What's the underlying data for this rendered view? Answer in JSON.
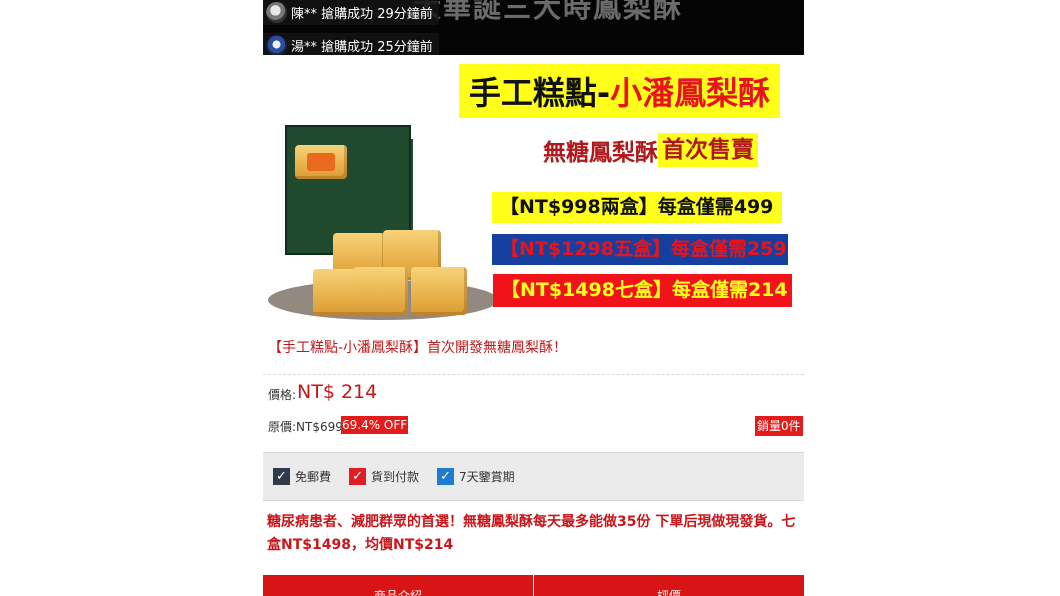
{
  "topbar": {
    "deco_text": "大華誕三大時鳳梨酥",
    "notices": [
      {
        "name": "陳**",
        "text": "陳** 搶購成功 29分鐘前"
      },
      {
        "name": "湯**",
        "text": "湯** 搶購成功 25分鐘前"
      }
    ]
  },
  "promo": {
    "title_part1": "手工糕點-",
    "title_part2": "小潘鳳梨酥",
    "sub_part1": "無糖鳳梨酥",
    "sub_part2": "首次售賣",
    "offers": [
      "【NT$998兩盒】每盒僅需499",
      "【NT$1298五盒】每盒僅需259",
      "【NT$1498七盒】每盒僅需214"
    ],
    "colors": {
      "yellow": "#ffff1a",
      "red": "#f2121a",
      "blue": "#1640a0"
    }
  },
  "product": {
    "title": "【手工糕點-小潘鳳梨酥】首次開發無糖鳳梨酥！",
    "price_label": "價格:",
    "price": "NT$ 214",
    "original_price_label": "原價:NT$699",
    "discount": "69.4% OFF",
    "sales": "銷量0件"
  },
  "features": [
    {
      "icon": "check-icon",
      "label": "免郵費"
    },
    {
      "icon": "check-icon",
      "label": "貨到付款"
    },
    {
      "icon": "check-icon",
      "label": "7天鑒賞期"
    }
  ],
  "description": "糖尿病患者、減肥群眾的首選！無糖鳳梨酥每天最多能做35份 下單后現做現發貨。七盒NT$1498，均價NT$214",
  "tabs": [
    "商品介紹",
    "評價"
  ],
  "accent_color": "#d81414"
}
